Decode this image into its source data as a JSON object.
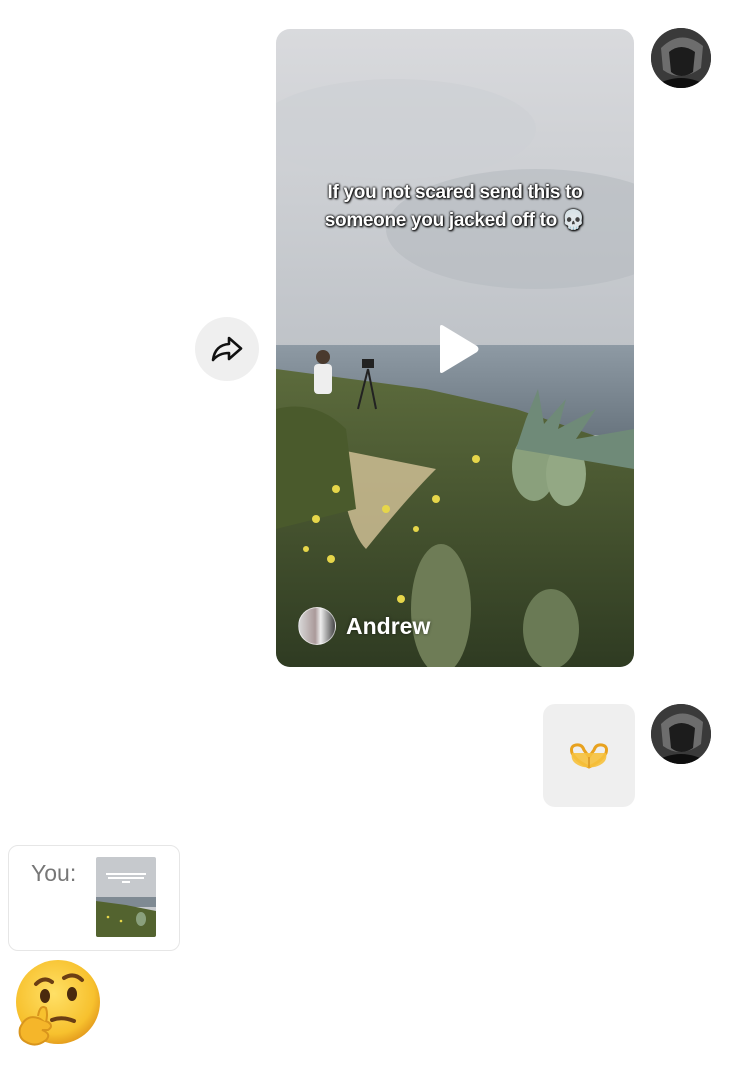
{
  "conversation": {
    "shared_video": {
      "caption": "If you not scared send this to someone you jacked off to 💀",
      "author": "Andrew",
      "avatar_icon": "author-avatar"
    },
    "share_button": {
      "icon": "share-arrow-icon"
    },
    "heart_hands_message": {
      "emoji": "heart-hands-emoji"
    },
    "reply": {
      "label": "You:",
      "thumbnail_caption": "If you not scared send this to someone you jacked off to"
    },
    "reaction_message": {
      "emoji": "thinking-face-emoji"
    }
  },
  "colors": {
    "bubble_bg": "#efefef",
    "text_gray": "#777777",
    "play": "#ffffff",
    "heart_hands": "#f5b82a"
  }
}
